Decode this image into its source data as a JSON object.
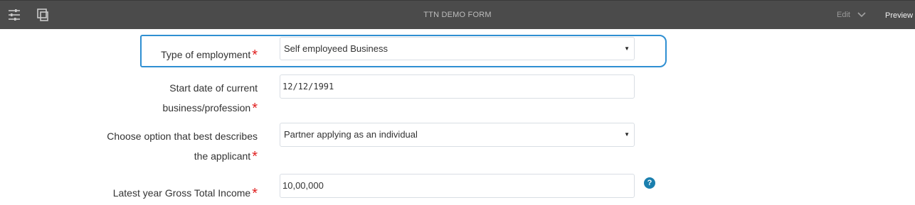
{
  "toolbar": {
    "title": "TTN DEMO FORM",
    "edit_label": "Edit",
    "preview_label": "Preview",
    "icons": [
      "sliders-icon",
      "layout-icon",
      "chevron-down-icon"
    ]
  },
  "form": {
    "employment_type": {
      "label": "Type of employment",
      "required_mark": "*",
      "value": "Self employeed Business",
      "arrow": "▼"
    },
    "start_date": {
      "label_line1": "Start date of current",
      "label_line2": "business/profession",
      "required_mark": "*",
      "value": "12/12/1991"
    },
    "applicant_option": {
      "label_line1": "Choose option that best describes",
      "label_line2": "the applicant",
      "required_mark": "*",
      "value": "Partner applying as an individual",
      "arrow": "▼"
    },
    "gross_income": {
      "label": "Latest year Gross Total Income",
      "required_mark": "*",
      "value": "10,00,000",
      "help_glyph": "?"
    }
  },
  "colors": {
    "toolbar_bg": "#4b4b4b",
    "focus_border": "#2f8fd2",
    "required": "#e02020",
    "help_badge": "#1a7fae"
  }
}
